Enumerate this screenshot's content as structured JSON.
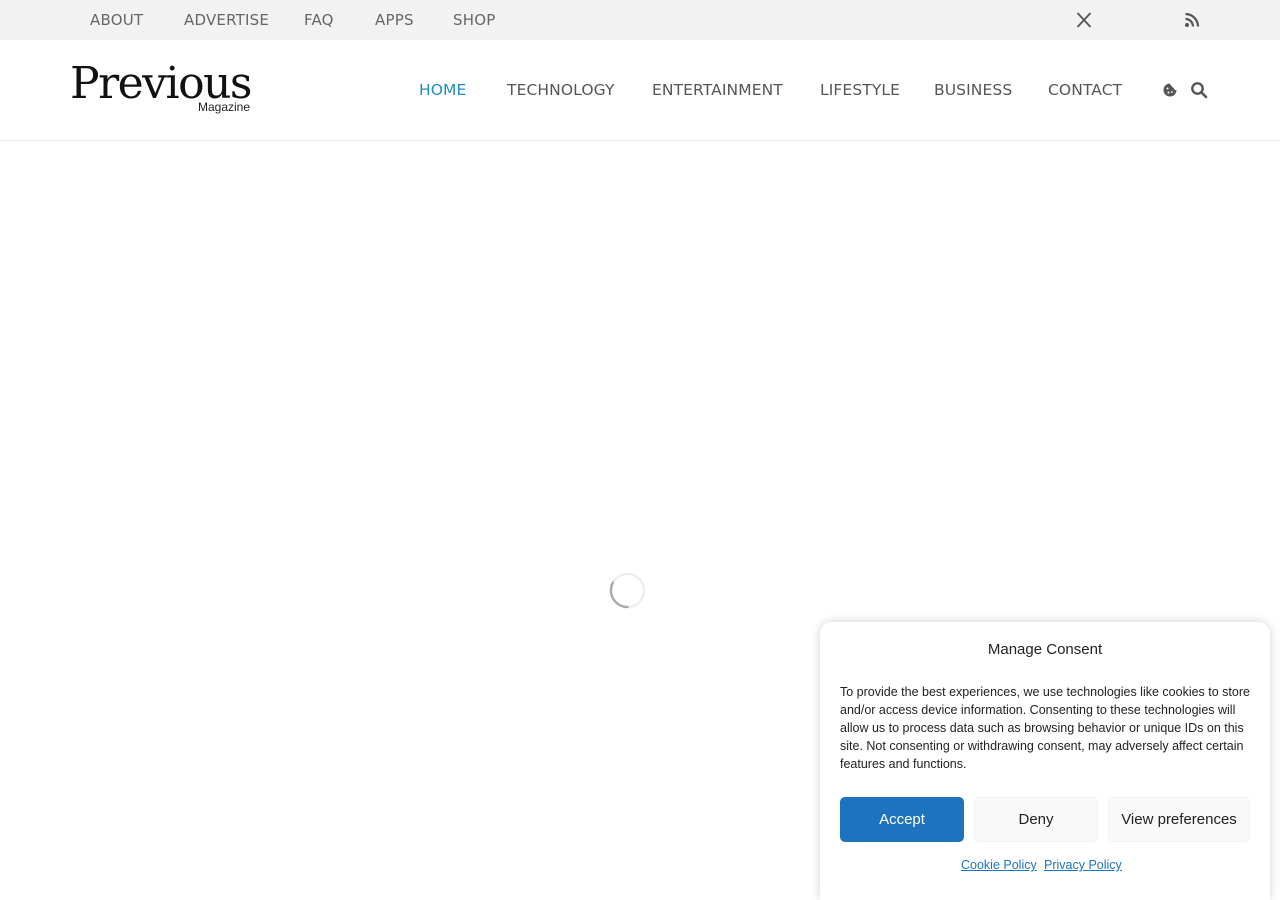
{
  "topbar": {
    "links": [
      "ABOUT",
      "ADVERTISE",
      "FAQ",
      "APPS",
      "SHOP"
    ],
    "social": [
      "x-twitter-icon",
      "rss-icon"
    ]
  },
  "header": {
    "logo": {
      "main": "Previous",
      "sub": "Magazine"
    },
    "nav": [
      "HOME",
      "TECHNOLOGY",
      "ENTERTAINMENT",
      "LIFESTYLE",
      "BUSINESS",
      "CONTACT"
    ],
    "active_nav": "HOME",
    "icons": [
      "cookie-icon",
      "search-icon"
    ]
  },
  "main": {
    "loading": true
  },
  "consent": {
    "title": "Manage Consent",
    "text": "To provide the best experiences, we use technologies like cookies to store and/or access device information. Consenting to these technologies will allow us to process data such as browsing behavior or unique IDs on this site. Not consenting or withdrawing consent, may adversely affect certain features and functions.",
    "accept": "Accept",
    "deny": "Deny",
    "preferences": "View preferences",
    "cookie_policy": "Cookie Policy",
    "privacy_policy": "Privacy Policy"
  },
  "colors": {
    "accent": "#1e8bc3",
    "button_primary": "#1e73be",
    "topbar_bg": "#f2f2f2"
  }
}
